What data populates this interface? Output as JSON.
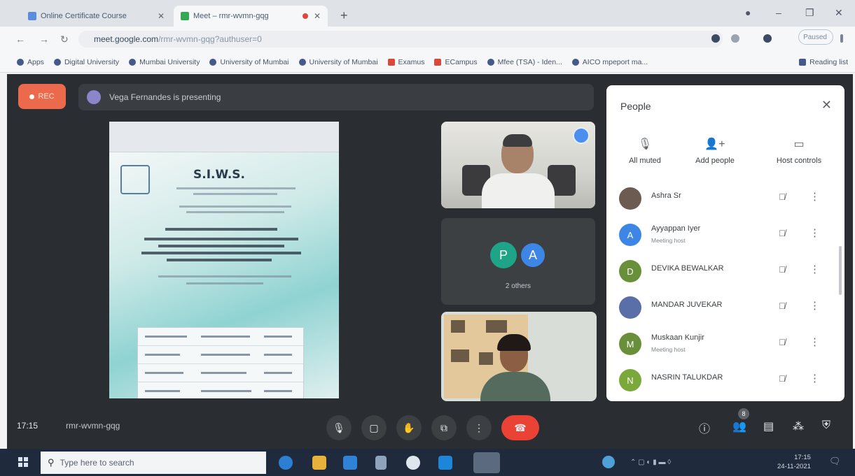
{
  "browser": {
    "tabs": [
      {
        "label": "Online Certificate Course"
      },
      {
        "label": "Meet – rmr-wvmn-gqg"
      }
    ],
    "new_tab": "+",
    "url_host": "meet.google.com",
    "url_path": "/rmr-wvmn-gqg?authuser=0",
    "profile_label": "Paused",
    "bookmarks": [
      "Apps",
      "Digital University",
      "Mumbai University",
      "University of Mumbai",
      "University of Mumbai",
      "Examus",
      "ECampus",
      "Mfee (TSA) - Iden...",
      "AICO mpeport ma...",
      "Reading list"
    ]
  },
  "meet": {
    "rec_label": "REC",
    "presenter": "Vega Fernandes is presenting",
    "doc": {
      "title": "S.I.W.S."
    },
    "group_tile": {
      "initials": [
        "P",
        "A"
      ],
      "label": "2 others"
    },
    "people_panel": {
      "title": "People",
      "actions": [
        "All muted",
        "Add people",
        "Host controls"
      ],
      "participants": [
        {
          "name": "Ashra Sr",
          "sub": "",
          "initial": "",
          "color": "#6b5b50"
        },
        {
          "name": "Ayyappan Iyer",
          "sub": "Meeting host",
          "initial": "A",
          "color": "#3d86e5"
        },
        {
          "name": "DEVIKA BEWALKAR",
          "sub": "",
          "initial": "D",
          "color": "#6a8f3a"
        },
        {
          "name": "MANDAR JUVEKAR",
          "sub": "",
          "initial": "",
          "color": "#5a6fa8"
        },
        {
          "name": "Muskaan Kunjir",
          "sub": "Meeting host",
          "initial": "M",
          "color": "#6a8f3a"
        },
        {
          "name": "NASRIN TALUKDAR",
          "sub": "",
          "initial": "N",
          "color": "#7aa83a"
        }
      ]
    },
    "bottom": {
      "time": "17:15",
      "code": "rmr-wvmn-gqg",
      "people_count": "8"
    }
  },
  "taskbar": {
    "search_placeholder": "Type here to search",
    "time": "17:15",
    "date": "24-11-2021"
  },
  "colors": {
    "meet_bg": "#2a2d31",
    "rec": "#ea6a4b",
    "end_call": "#ea4335",
    "taskbar": "#1f2b3c"
  }
}
